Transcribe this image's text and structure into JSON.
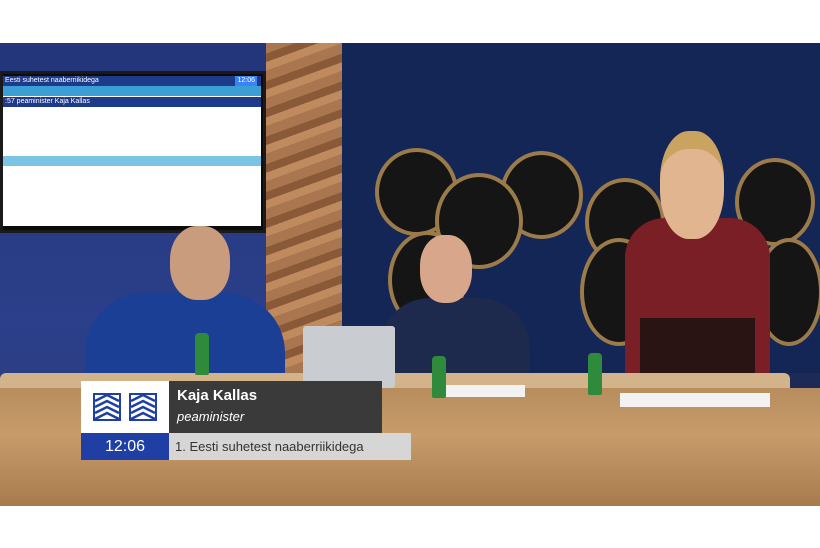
{
  "screen": {
    "title": "Eesti suhetest naaberriikidega",
    "time": "12:06",
    "selected_row": ":57 peaminister Kaja Kallas"
  },
  "lower_third": {
    "name": "Kaja Kallas",
    "role": "peaminister",
    "time": "12:06",
    "agenda_item": "1. Eesti suhetest naaberriikidega",
    "logo_icon": "riigikogu-logo-icon"
  },
  "colors": {
    "time_box": "#1f3fa4",
    "name_box": "#3a3a3a",
    "agenda_box": "#d6d6d6"
  }
}
